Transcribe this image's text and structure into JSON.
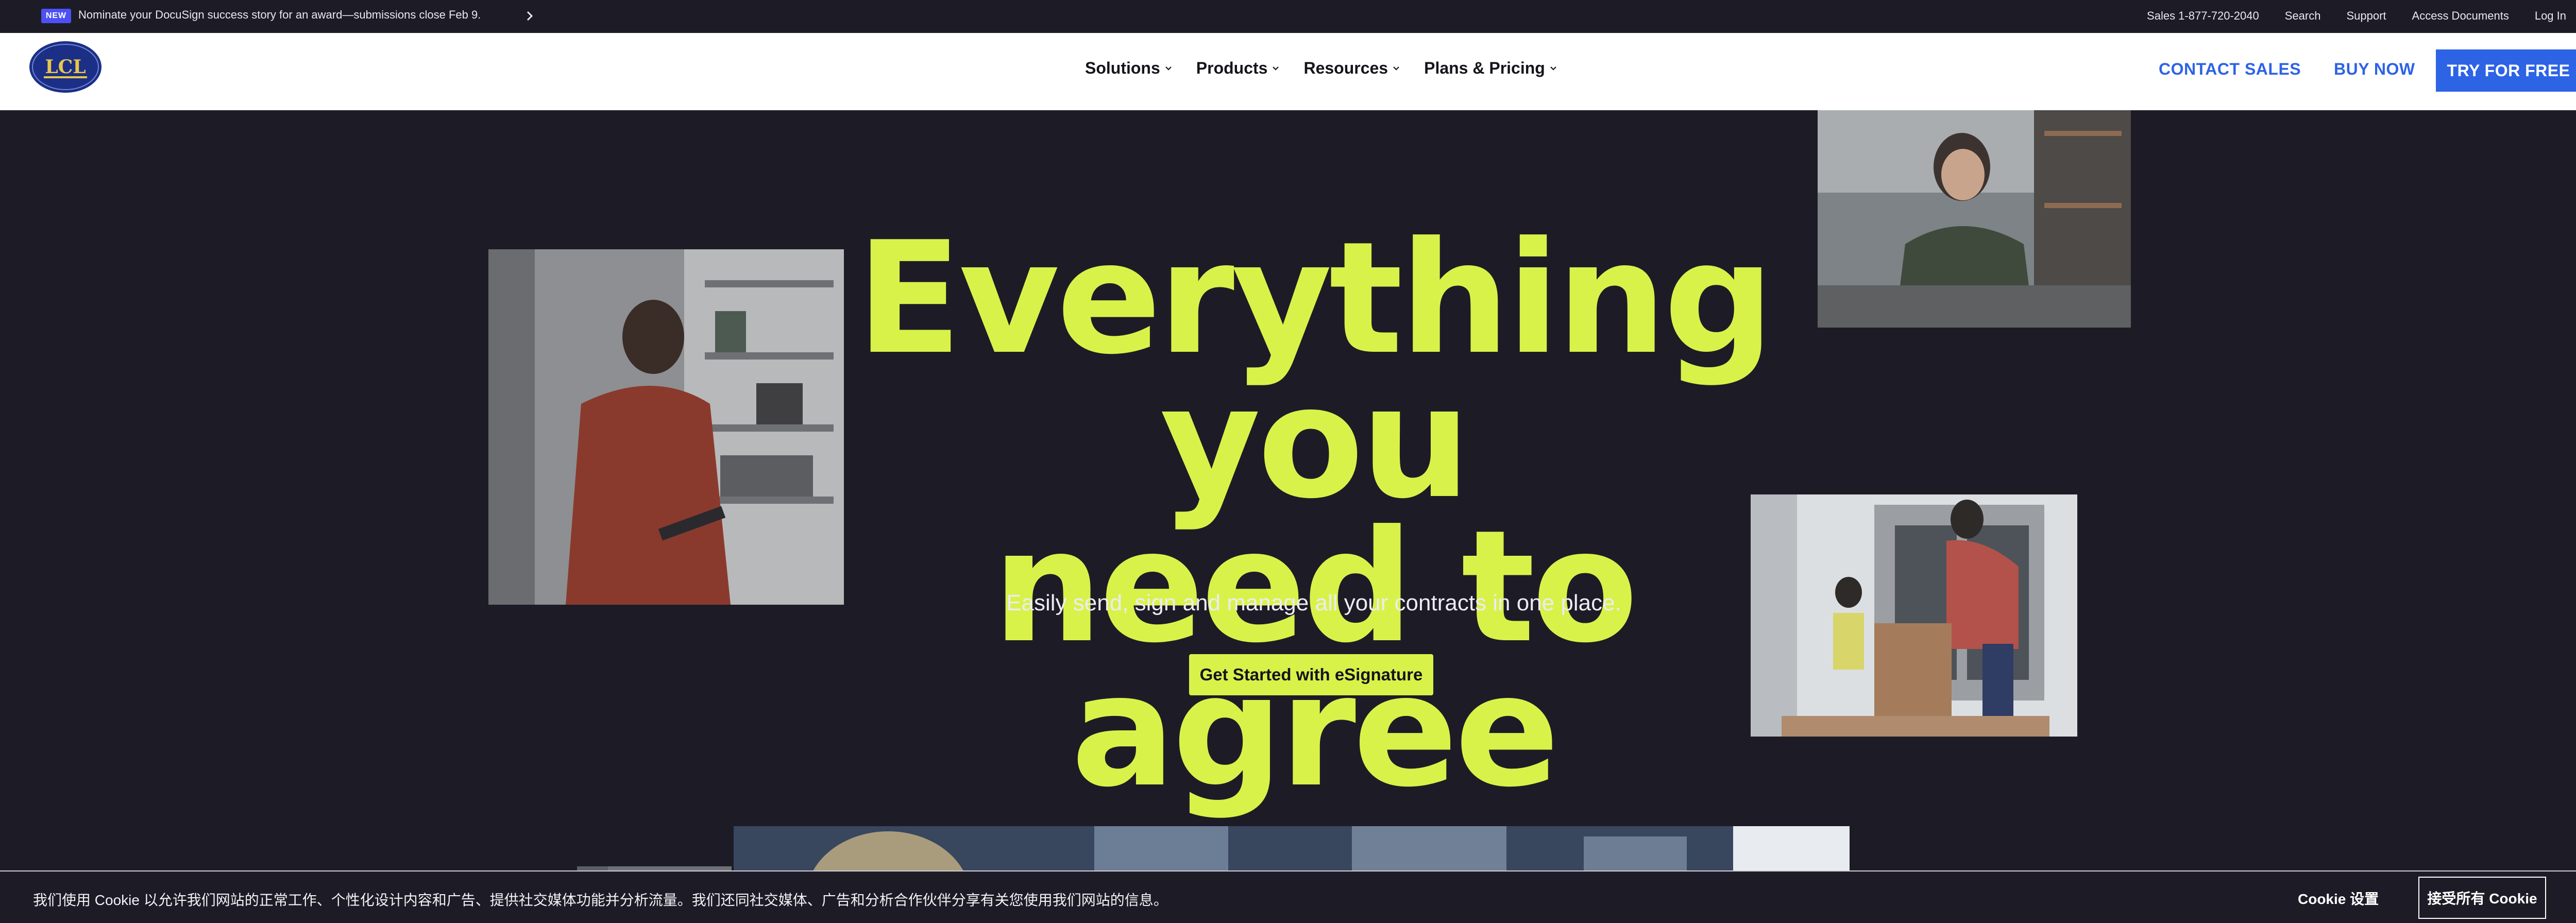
{
  "announcement": {
    "badge": "NEW",
    "text": "Nominate your DocuSign success story for an award—submissions close Feb 9."
  },
  "utility_links": [
    "Sales 1-877-720-2040",
    "Search",
    "Support",
    "Access Documents",
    "Log In"
  ],
  "logo": {
    "text": "LCL"
  },
  "nav": {
    "menu": [
      "Solutions",
      "Products",
      "Resources",
      "Plans & Pricing"
    ],
    "contact_sales": "CONTACT SALES",
    "buy_now": "BUY NOW",
    "try_free": "TRY FOR FREE"
  },
  "hero": {
    "title_line1": "Everything you",
    "title_line2": "need to agree",
    "subtitle": "Easily send, sign and manage all your contracts in one place.",
    "cta": "Get Started with eSignature"
  },
  "cookie_banner": {
    "text": "我们使用 Cookie 以允许我们网站的正常工作、个性化设计内容和广告、提供社交媒体功能并分析流量。我们还同社交媒体、广告和分析合作伙伴分享有关您使用我们网站的信息。",
    "settings": "Cookie 设置",
    "accept": "接受所有 Cookie"
  },
  "colors": {
    "background": "#1d1c26",
    "accent_lime": "#d9f24a",
    "link_blue": "#2d63e5",
    "badge": "#4c51f5"
  }
}
